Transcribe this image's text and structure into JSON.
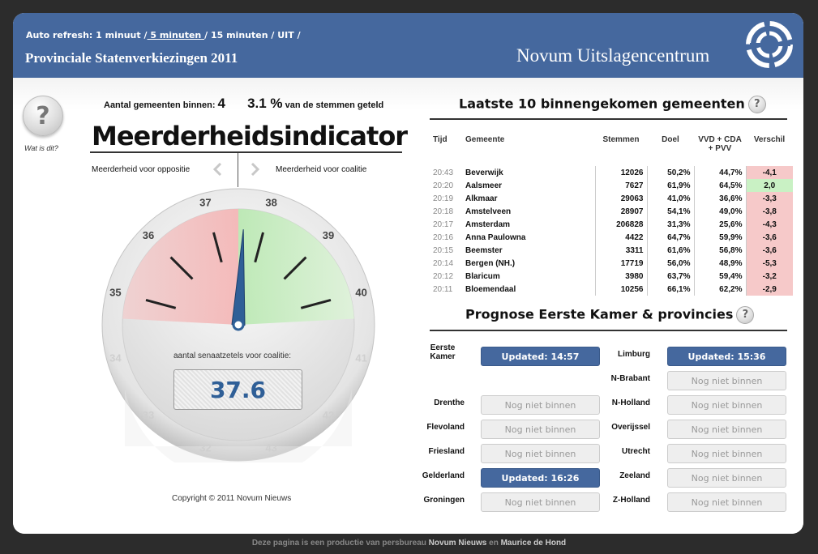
{
  "header": {
    "refresh_label": "Auto refresh:",
    "refresh_options": [
      "1 minuut",
      "5 minuten",
      "15 minuten",
      "UIT"
    ],
    "refresh_active": "5 minuten",
    "subtitle": "Provinciale Statenverkiezingen 2011",
    "brand": "Novum Uitslagencentrum"
  },
  "left": {
    "help_symbol": "?",
    "help_label": "Wat is dit?",
    "count_label": "Aantal gemeenten binnen:",
    "count_value": "4",
    "pct_value": "3.1 %",
    "pct_label": "van de stemmen geteld",
    "title": "Meerderheidsindicator",
    "left_label": "Meerderheid voor oppositie",
    "right_label": "Meerderheid voor coalitie",
    "dial_caption": "aantal senaatzetels voor coalitie:",
    "dial_value": "37.6",
    "needle_value": 37.6,
    "scale_ticks": [
      "32",
      "33",
      "34",
      "35",
      "36",
      "37",
      "38",
      "39",
      "40",
      "41",
      "42",
      "43"
    ],
    "copyright": "Copyright © 2011 Novum Nieuws"
  },
  "results": {
    "title": "Laatste 10 binnengekomen gemeenten",
    "columns": [
      "Tijd",
      "Gemeente",
      "Stemmen",
      "Doel",
      "VVD + CDA + PVV",
      "Verschil"
    ],
    "rows": [
      {
        "tijd": "20:43",
        "gemeente": "Beverwijk",
        "stemmen": "12026",
        "doel": "50,2%",
        "coal": "44,7%",
        "verschil": "-4,1",
        "pos": false
      },
      {
        "tijd": "20:20",
        "gemeente": "Aalsmeer",
        "stemmen": "7627",
        "doel": "61,9%",
        "coal": "64,5%",
        "verschil": "2,0",
        "pos": true
      },
      {
        "tijd": "20:19",
        "gemeente": "Alkmaar",
        "stemmen": "29063",
        "doel": "41,0%",
        "coal": "36,6%",
        "verschil": "-3,3",
        "pos": false
      },
      {
        "tijd": "20:18",
        "gemeente": "Amstelveen",
        "stemmen": "28907",
        "doel": "54,1%",
        "coal": "49,0%",
        "verschil": "-3,8",
        "pos": false
      },
      {
        "tijd": "20:17",
        "gemeente": "Amsterdam",
        "stemmen": "206828",
        "doel": "31,3%",
        "coal": "25,6%",
        "verschil": "-4,3",
        "pos": false
      },
      {
        "tijd": "20:16",
        "gemeente": "Anna Paulowna",
        "stemmen": "4422",
        "doel": "64,7%",
        "coal": "59,9%",
        "verschil": "-3,6",
        "pos": false
      },
      {
        "tijd": "20:15",
        "gemeente": "Beemster",
        "stemmen": "3311",
        "doel": "61,6%",
        "coal": "56,8%",
        "verschil": "-3,6",
        "pos": false
      },
      {
        "tijd": "20:14",
        "gemeente": "Bergen (NH.)",
        "stemmen": "17719",
        "doel": "56,0%",
        "coal": "48,9%",
        "verschil": "-5,3",
        "pos": false
      },
      {
        "tijd": "20:12",
        "gemeente": "Blaricum",
        "stemmen": "3980",
        "doel": "63,7%",
        "coal": "59,4%",
        "verschil": "-3,2",
        "pos": false
      },
      {
        "tijd": "20:11",
        "gemeente": "Bloemendaal",
        "stemmen": "10256",
        "doel": "66,1%",
        "coal": "62,2%",
        "verschil": "-2,9",
        "pos": false
      }
    ]
  },
  "prognose": {
    "title": "Prognose Eerste Kamer & provincies",
    "left": [
      {
        "label": "Eerste Kamer",
        "status": "Updated: 14:57",
        "updated": true
      },
      {
        "label": "",
        "status": "",
        "updated": false
      },
      {
        "label": "Drenthe",
        "status": "Nog niet binnen",
        "updated": false
      },
      {
        "label": "Flevoland",
        "status": "Nog niet binnen",
        "updated": false
      },
      {
        "label": "Friesland",
        "status": "Nog niet binnen",
        "updated": false
      },
      {
        "label": "Gelderland",
        "status": "Updated: 16:26",
        "updated": true
      },
      {
        "label": "Groningen",
        "status": "Nog niet binnen",
        "updated": false
      }
    ],
    "right": [
      {
        "label": "Limburg",
        "status": "Updated: 15:36",
        "updated": true
      },
      {
        "label": "N-Brabant",
        "status": "Nog niet binnen",
        "updated": false
      },
      {
        "label": "N-Holland",
        "status": "Nog niet binnen",
        "updated": false
      },
      {
        "label": "Overijssel",
        "status": "Nog niet binnen",
        "updated": false
      },
      {
        "label": "Utrecht",
        "status": "Nog niet binnen",
        "updated": false
      },
      {
        "label": "Zeeland",
        "status": "Nog niet binnen",
        "updated": false
      },
      {
        "label": "Z-Holland",
        "status": "Nog niet binnen",
        "updated": false
      }
    ]
  },
  "footer": {
    "text1": "Deze pagina is een productie van persbureau",
    "brand1": "Novum Nieuws",
    "text2": "en",
    "brand2": "Maurice de Hond"
  },
  "colors": {
    "header": "#45689e",
    "positive": "#c9f1c4",
    "negative": "#f6c9c9",
    "needle": "#2f5f97"
  }
}
